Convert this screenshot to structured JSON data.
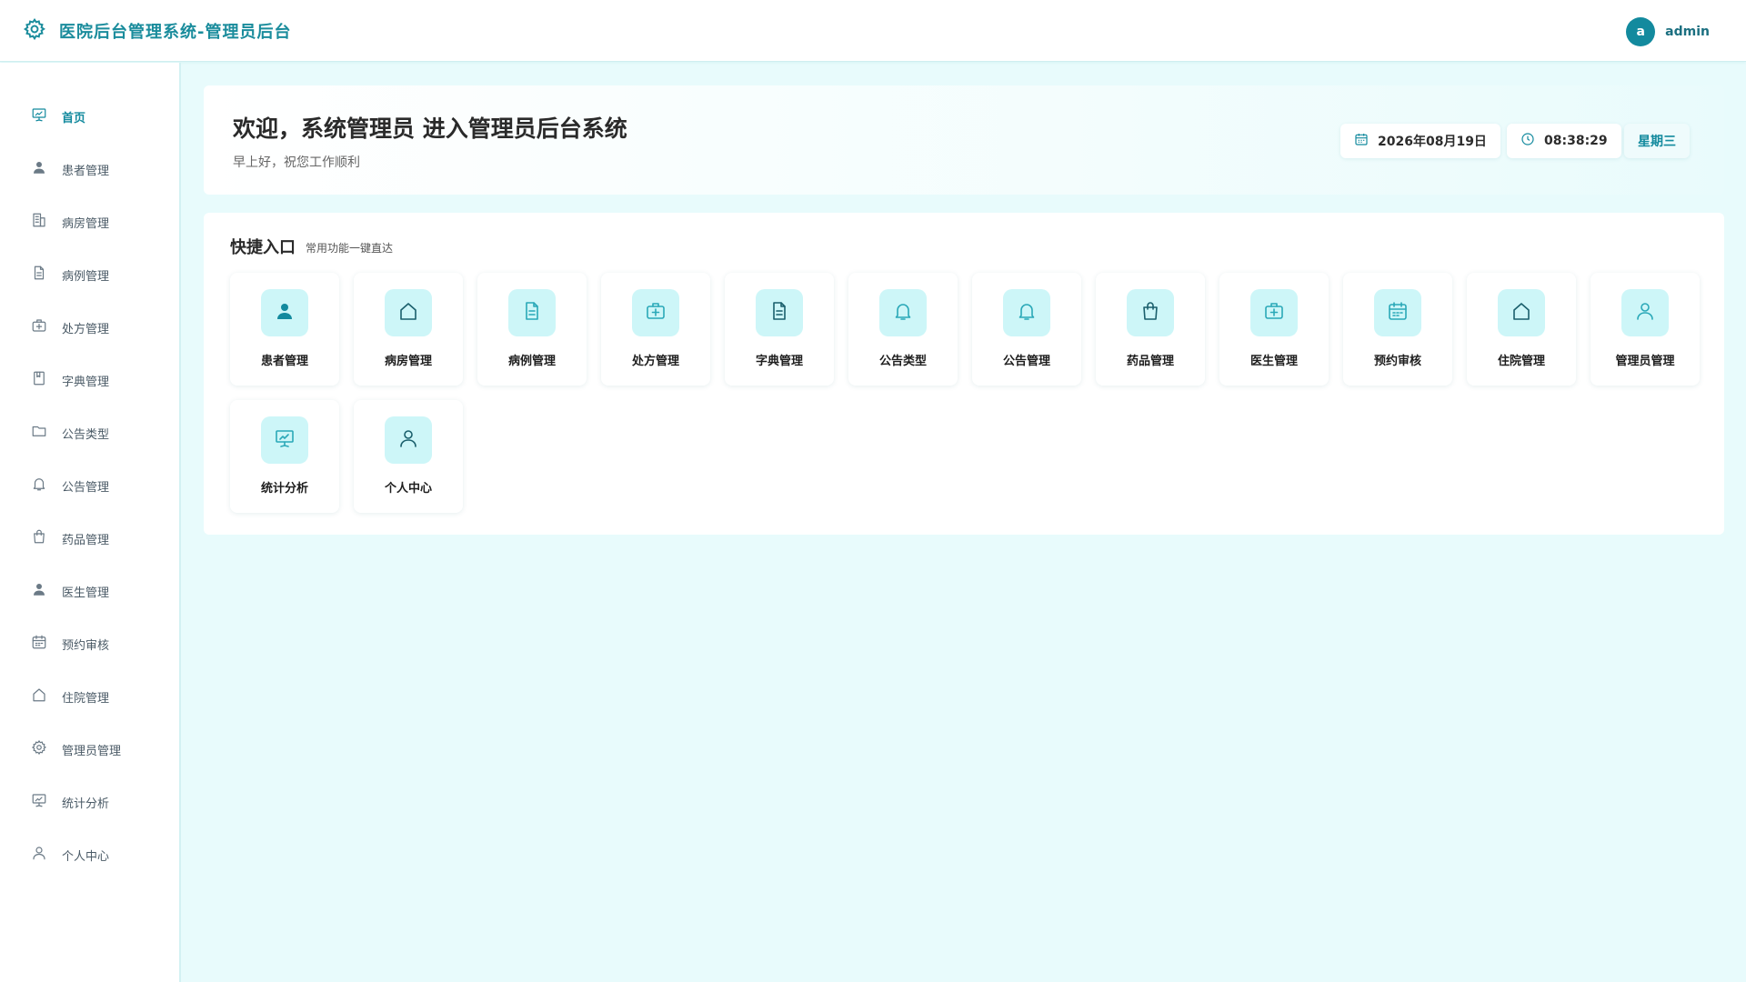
{
  "header": {
    "title": "医院后台管理系统-管理员后台",
    "avatar_letter": "a",
    "username": "admin"
  },
  "sidebar": {
    "items": [
      {
        "label": "首页",
        "icon": "presentation-chart-icon",
        "active": true
      },
      {
        "label": "患者管理",
        "icon": "user-filled-icon"
      },
      {
        "label": "病房管理",
        "icon": "building-icon"
      },
      {
        "label": "病例管理",
        "icon": "document-icon"
      },
      {
        "label": "处方管理",
        "icon": "first-aid-kit-icon"
      },
      {
        "label": "字典管理",
        "icon": "notebook-icon"
      },
      {
        "label": "公告类型",
        "icon": "folder-icon"
      },
      {
        "label": "公告管理",
        "icon": "bell-icon"
      },
      {
        "label": "药品管理",
        "icon": "shopping-bag-icon"
      },
      {
        "label": "医生管理",
        "icon": "user-filled-icon"
      },
      {
        "label": "预约审核",
        "icon": "calendar-icon"
      },
      {
        "label": "住院管理",
        "icon": "house-icon"
      },
      {
        "label": "管理员管理",
        "icon": "gear-icon"
      },
      {
        "label": "统计分析",
        "icon": "presentation-chart-icon"
      },
      {
        "label": "个人中心",
        "icon": "user-outline-icon"
      }
    ]
  },
  "welcome": {
    "title": "欢迎，系统管理员 进入管理员后台系统",
    "subtitle": "早上好，祝您工作顺利",
    "date": "2026年08月19日",
    "time": "08:38:29",
    "weekday": "星期三"
  },
  "quick": {
    "title": "快捷入口",
    "subtitle": "常用功能一键直达",
    "tiles": [
      {
        "label": "患者管理",
        "icon": "user-filled-icon"
      },
      {
        "label": "病房管理",
        "icon": "house-icon"
      },
      {
        "label": "病例管理",
        "icon": "document-icon"
      },
      {
        "label": "处方管理",
        "icon": "first-aid-kit-icon"
      },
      {
        "label": "字典管理",
        "icon": "document-icon"
      },
      {
        "label": "公告类型",
        "icon": "bell-icon"
      },
      {
        "label": "公告管理",
        "icon": "bell-icon"
      },
      {
        "label": "药品管理",
        "icon": "shopping-bag-icon"
      },
      {
        "label": "医生管理",
        "icon": "first-aid-kit-icon"
      },
      {
        "label": "预约审核",
        "icon": "calendar-icon"
      },
      {
        "label": "住院管理",
        "icon": "house-icon"
      },
      {
        "label": "管理员管理",
        "icon": "user-outline-icon"
      },
      {
        "label": "统计分析",
        "icon": "presentation-chart-icon"
      },
      {
        "label": "个人中心",
        "icon": "user-outline-icon"
      }
    ]
  },
  "colors": {
    "accent": "#138a9e",
    "tile_bg": "#cdf6f8",
    "page_bg": "#e8fbfc"
  }
}
